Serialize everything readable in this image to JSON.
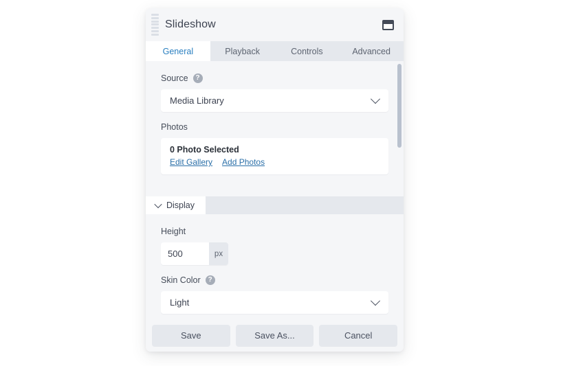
{
  "window": {
    "title": "Slideshow",
    "drag_handle_icon": "grip-dots-icon",
    "window_mode_icon": "window-frame-icon"
  },
  "tabs": [
    {
      "label": "General",
      "active": true
    },
    {
      "label": "Playback",
      "active": false
    },
    {
      "label": "Controls",
      "active": false
    },
    {
      "label": "Advanced",
      "active": false
    }
  ],
  "general": {
    "source": {
      "label": "Source",
      "help_icon": "help-circle-icon",
      "value": "Media Library",
      "chevron_icon": "chevron-down-icon"
    },
    "photos": {
      "label": "Photos",
      "count_text": "0 Photo Selected",
      "edit_gallery_link": "Edit Gallery",
      "add_photos_link": "Add Photos"
    }
  },
  "display_section": {
    "title": "Display",
    "chevron_icon": "chevron-down-icon",
    "height": {
      "label": "Height",
      "value": "500",
      "unit": "px"
    },
    "skin_color": {
      "label": "Skin Color",
      "help_icon": "help-circle-icon",
      "value": "Light",
      "chevron_icon": "chevron-down-icon"
    }
  },
  "footer": {
    "save_label": "Save",
    "save_as_label": "Save As...",
    "cancel_label": "Cancel"
  },
  "colors": {
    "accent": "#2a7fc0",
    "link": "#2a6fa8",
    "panel_bg": "#f5f6f8",
    "strip_bg": "#e5e8ed",
    "text": "#3c4250"
  }
}
